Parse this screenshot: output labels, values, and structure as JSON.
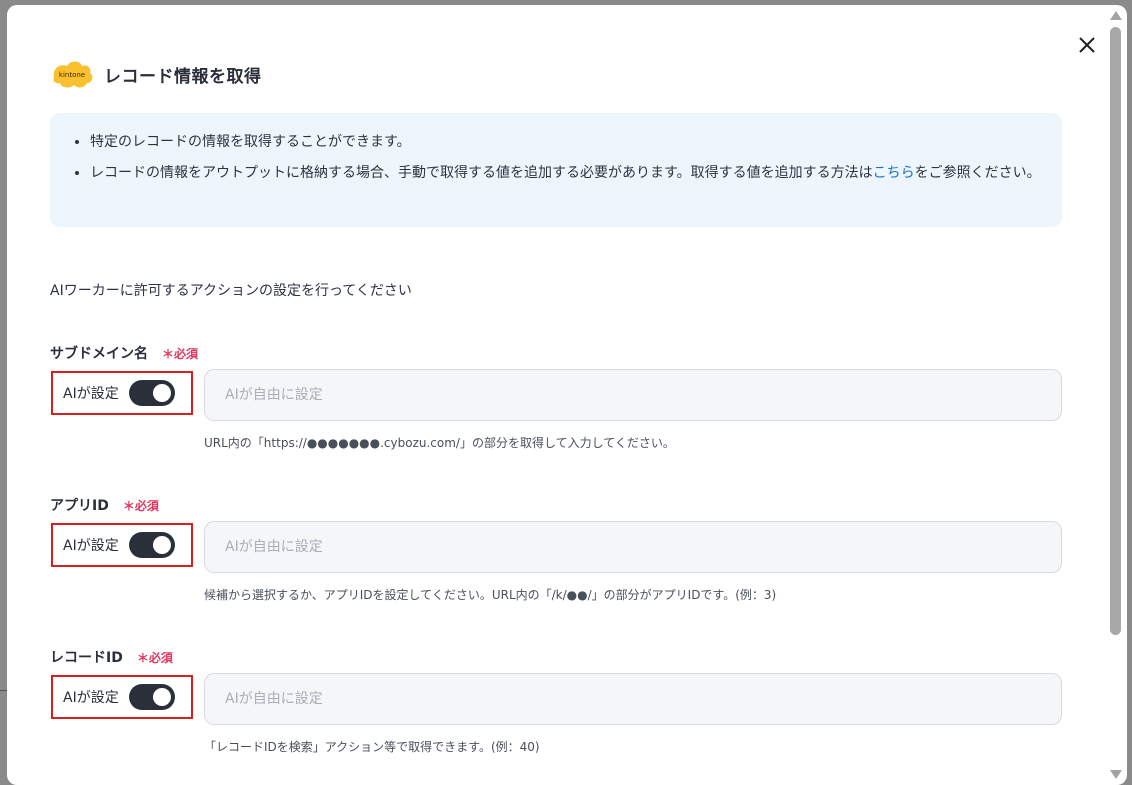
{
  "modal": {
    "title": "レコード情報を取得",
    "logo_text": "kintone",
    "brand_color": "#fbc02d"
  },
  "info": {
    "bullet_1": "特定のレコードの情報を取得することができます。",
    "bullet_2_before_link": "レコードの情報をアウトプットに格納する場合、手動で取得する値を追加する必要があります。取得する値を追加する方法は",
    "bullet_2_link": "こちら",
    "bullet_2_after_link": "をご参照ください。"
  },
  "intro": "AIワーカーに許可するアクションの設定を行ってください",
  "required_label": "＊必須",
  "fields": [
    {
      "label": "サブドメイン名",
      "ai_label": "AIが設定",
      "toggle_on": true,
      "placeholder": "AIが自由に設定",
      "hint": "URL内の「https://●●●●●●●.cybozu.com/」の部分を取得して入力してください。"
    },
    {
      "label": "アプリID",
      "ai_label": "AIが設定",
      "toggle_on": true,
      "placeholder": "AIが自由に設定",
      "hint": "候補から選択するか、アプリIDを設定してください。URL内の「/k/●●/」の部分がアプリIDです。(例：3)"
    },
    {
      "label": "レコードID",
      "ai_label": "AIが設定",
      "toggle_on": true,
      "placeholder": "AIが自由に設定",
      "hint": "「レコードIDを検索」アクション等で取得できます。(例：40)"
    }
  ]
}
